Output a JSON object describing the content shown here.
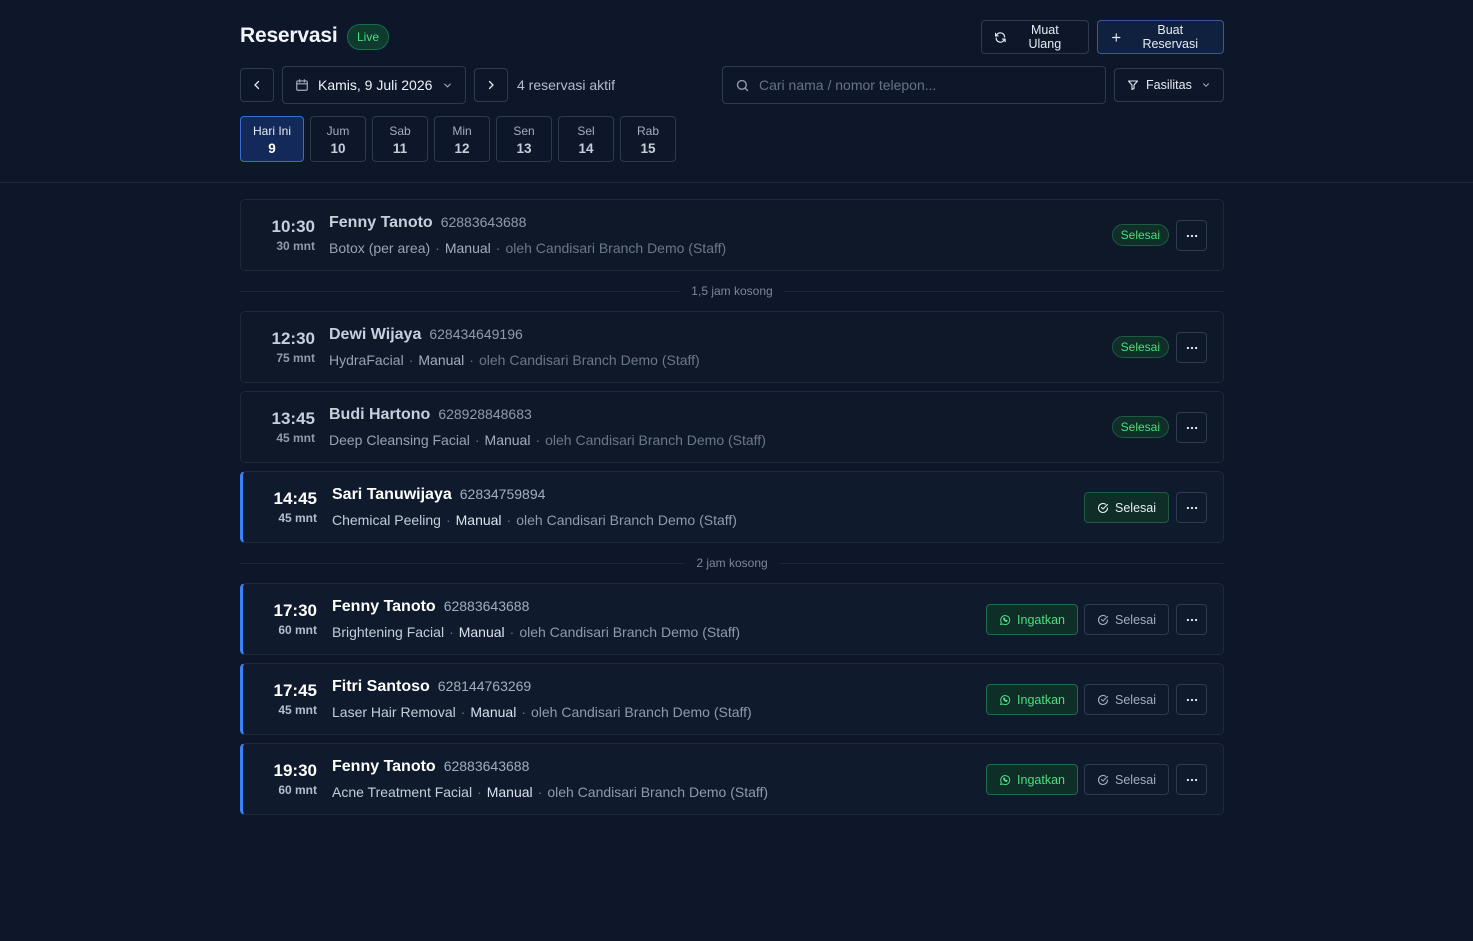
{
  "header": {
    "title": "Reservasi",
    "live_label": "Live",
    "reload_label": "Muat Ulang",
    "create_label": "Buat Reservasi",
    "date_label": "Kamis, 9 Juli 2026",
    "active_count": "4 reservasi aktif",
    "search_placeholder": "Cari nama / nomor telepon...",
    "facility_label": "Fasilitas"
  },
  "days": [
    {
      "name": "Hari Ini",
      "num": "9"
    },
    {
      "name": "Jum",
      "num": "10"
    },
    {
      "name": "Sab",
      "num": "11"
    },
    {
      "name": "Min",
      "num": "12"
    },
    {
      "name": "Sen",
      "num": "13"
    },
    {
      "name": "Sel",
      "num": "14"
    },
    {
      "name": "Rab",
      "num": "15"
    }
  ],
  "gaps": [
    "1,5 jam kosong",
    "2 jam kosong"
  ],
  "reservations": [
    {
      "time": "10:30",
      "duration": "30 mnt",
      "name": "Fenny Tanoto",
      "phone": "62883643688",
      "service": "Botox (per area)",
      "source": "Manual",
      "by": "oleh Candisari Branch Demo (Staff)",
      "status": "Selesai"
    },
    {
      "time": "12:30",
      "duration": "75 mnt",
      "name": "Dewi Wijaya",
      "phone": "628434649196",
      "service": "HydraFacial",
      "source": "Manual",
      "by": "oleh Candisari Branch Demo (Staff)",
      "status": "Selesai"
    },
    {
      "time": "13:45",
      "duration": "45 mnt",
      "name": "Budi Hartono",
      "phone": "628928848683",
      "service": "Deep Cleansing Facial",
      "source": "Manual",
      "by": "oleh Candisari Branch Demo (Staff)",
      "status": "Selesai"
    },
    {
      "time": "14:45",
      "duration": "45 mnt",
      "name": "Sari Tanuwijaya",
      "phone": "62834759894",
      "service": "Chemical Peeling",
      "source": "Manual",
      "by": "oleh Candisari Branch Demo (Staff)",
      "done_label": "Selesai"
    },
    {
      "time": "17:30",
      "duration": "60 mnt",
      "name": "Fenny Tanoto",
      "phone": "62883643688",
      "service": "Brightening Facial",
      "source": "Manual",
      "by": "oleh Candisari Branch Demo (Staff)",
      "remind_label": "Ingatkan",
      "done_label": "Selesai"
    },
    {
      "time": "17:45",
      "duration": "45 mnt",
      "name": "Fitri Santoso",
      "phone": "628144763269",
      "service": "Laser Hair Removal",
      "source": "Manual",
      "by": "oleh Candisari Branch Demo (Staff)",
      "remind_label": "Ingatkan",
      "done_label": "Selesai"
    },
    {
      "time": "19:30",
      "duration": "60 mnt",
      "name": "Fenny Tanoto",
      "phone": "62883643688",
      "service": "Acne Treatment Facial",
      "source": "Manual",
      "by": "oleh Candisari Branch Demo (Staff)",
      "remind_label": "Ingatkan",
      "done_label": "Selesai"
    }
  ],
  "colors": {
    "background": "#0e1729",
    "accent_blue": "#3b82f6",
    "success_green": "#4ade80"
  },
  "icons": {
    "reload": "refresh-icon",
    "create": "plus-icon",
    "calendar": "calendar-icon",
    "search": "search-icon",
    "filter": "filter-icon",
    "remind": "whatsapp-icon",
    "done": "check-circle-icon",
    "more": "more-horizontal-icon"
  }
}
